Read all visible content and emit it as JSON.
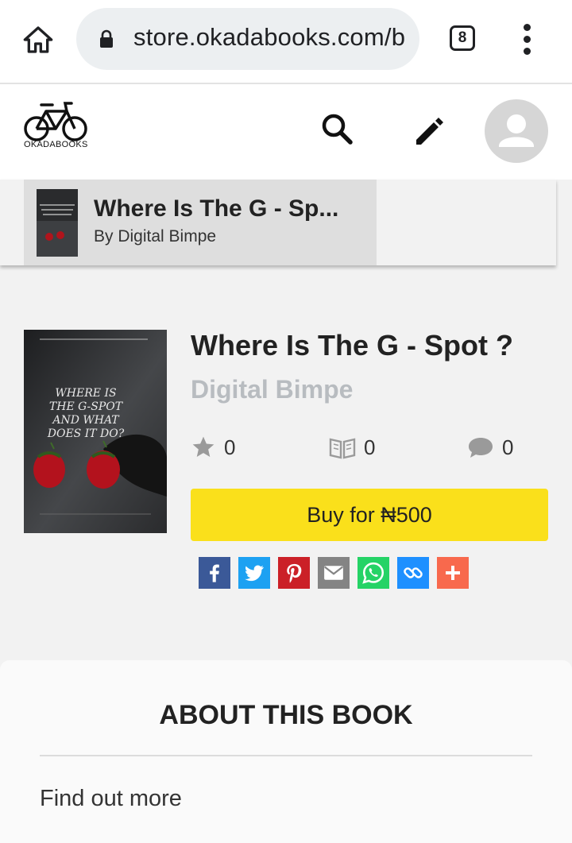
{
  "browser": {
    "url": "store.okadabooks.com/b",
    "tab_count": "8"
  },
  "site": {
    "logo_text": "OKADABOOKS"
  },
  "book_bar": {
    "title": "Where Is The G - Sp...",
    "author": "By Digital Bimpe"
  },
  "book": {
    "title": "Where Is The G - Spot ?",
    "author": "Digital Bimpe",
    "rating_count": "0",
    "reads_count": "0",
    "comments_count": "0",
    "buy_label": "Buy for ₦500",
    "cover_text": [
      "WHERE IS",
      "THE G-SPOT",
      "AND WHAT",
      "DOES IT DO?"
    ]
  },
  "share": [
    {
      "name": "facebook",
      "color": "#3b5998"
    },
    {
      "name": "twitter",
      "color": "#1da1f2"
    },
    {
      "name": "pinterest",
      "color": "#cb2027"
    },
    {
      "name": "email",
      "color": "#848484"
    },
    {
      "name": "whatsapp",
      "color": "#25d366"
    },
    {
      "name": "copy-link",
      "color": "#1e90ff"
    },
    {
      "name": "more",
      "color": "#f8694d"
    }
  ],
  "about": {
    "heading": "ABOUT THIS BOOK",
    "find_more": "Find out more"
  },
  "colors": {
    "buy_button": "#fae01b",
    "author_muted": "#b8bcc0"
  }
}
